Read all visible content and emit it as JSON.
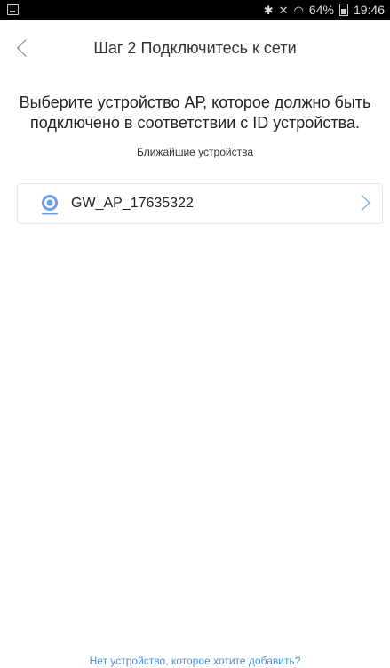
{
  "status_bar": {
    "bluetooth_icon": "bluetooth-icon",
    "mute_icon": "mute-icon",
    "wifi_icon": "wifi-icon",
    "battery": "64%",
    "time": "19:46"
  },
  "header": {
    "title": "Шаг 2 Подключитесь к сети"
  },
  "instruction": "Выберите устройство АР, которое должно быть подключено в соответствии с ID устройства.",
  "section_label": "Ближайшие устройства",
  "devices": [
    {
      "name": "GW_AP_17635322",
      "icon": "camera-icon"
    }
  ],
  "bottom_link": "Нет устройство, которое хотите добавить?",
  "colors": {
    "accent": "#5b9bd5",
    "link": "#4a90d9"
  }
}
